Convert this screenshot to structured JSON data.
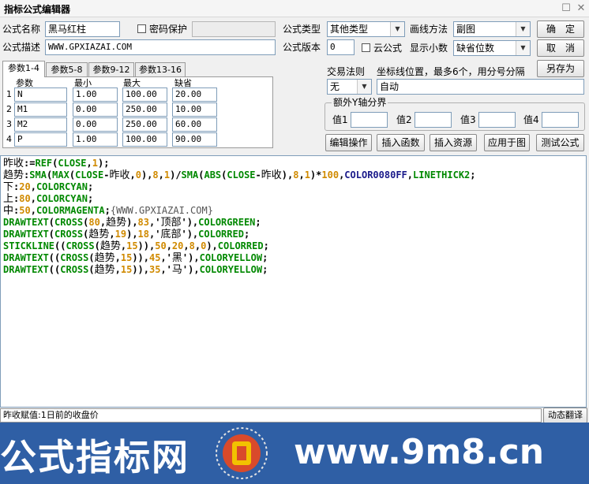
{
  "window": {
    "title": "指标公式编辑器",
    "restore_glyph": "☐",
    "close_glyph": "✕"
  },
  "form": {
    "name_label": "公式名称",
    "name_value": "黑马红柱",
    "password_label": "密码保护",
    "desc_label": "公式描述",
    "desc_value": "WWW.GPXIAZAI.COM",
    "type_label": "公式类型",
    "type_value": "其他类型",
    "draw_label": "画线方法",
    "draw_value": "副图",
    "version_label": "公式版本",
    "version_value": "0",
    "cloud_label": "云公式",
    "decimals_label": "显示小数",
    "decimals_value": "缺省位数"
  },
  "buttons": {
    "ok": "确　定",
    "cancel": "取　消",
    "save_as": "另存为",
    "edit_ops": "编辑操作",
    "insert_fn": "插入函数",
    "insert_res": "插入资源",
    "apply": "应用于图",
    "test": "测试公式"
  },
  "tabs": [
    "参数1-4",
    "参数5-8",
    "参数9-12",
    "参数13-16"
  ],
  "params": {
    "headers": [
      "参数",
      "最小",
      "最大",
      "缺省"
    ],
    "rows": [
      {
        "idx": "1",
        "name": "N",
        "min": "1.00",
        "max": "100.00",
        "def": "20.00"
      },
      {
        "idx": "2",
        "name": "M1",
        "min": "0.00",
        "max": "250.00",
        "def": "10.00"
      },
      {
        "idx": "3",
        "name": "M2",
        "min": "0.00",
        "max": "250.00",
        "def": "60.00"
      },
      {
        "idx": "4",
        "name": "P",
        "min": "1.00",
        "max": "100.00",
        "def": "90.00"
      }
    ]
  },
  "trade": {
    "label": "交易法则",
    "value": "无",
    "coord_label": "坐标线位置，最多6个，用分号分隔",
    "coord_value": "自动"
  },
  "yaxis": {
    "title": "额外Y轴分界",
    "labels": [
      "值1",
      "值2",
      "值3",
      "值4"
    ]
  },
  "code": [
    [
      [
        "cn",
        "昨收"
      ],
      [
        "id",
        ":="
      ],
      [
        "fn",
        "REF"
      ],
      [
        "id",
        "("
      ],
      [
        "fn",
        "CLOSE"
      ],
      [
        "id",
        ","
      ],
      [
        "num",
        "1"
      ],
      [
        "id",
        ");"
      ]
    ],
    [
      [
        "cn",
        "趋势"
      ],
      [
        "id",
        ":"
      ],
      [
        "fn",
        "SMA"
      ],
      [
        "id",
        "("
      ],
      [
        "fn",
        "MAX"
      ],
      [
        "id",
        "("
      ],
      [
        "fn",
        "CLOSE"
      ],
      [
        "id",
        "-"
      ],
      [
        "cn",
        "昨收"
      ],
      [
        "id",
        ","
      ],
      [
        "num",
        "0"
      ],
      [
        "id",
        "),"
      ],
      [
        "num",
        "8"
      ],
      [
        "id",
        ","
      ],
      [
        "num",
        "1"
      ],
      [
        "id",
        ")/"
      ],
      [
        "fn",
        "SMA"
      ],
      [
        "id",
        "("
      ],
      [
        "fn",
        "ABS"
      ],
      [
        "id",
        "("
      ],
      [
        "fn",
        "CLOSE"
      ],
      [
        "id",
        "-"
      ],
      [
        "cn",
        "昨收"
      ],
      [
        "id",
        "),"
      ],
      [
        "num",
        "8"
      ],
      [
        "id",
        ","
      ],
      [
        "num",
        "1"
      ],
      [
        "id",
        ")*"
      ],
      [
        "num",
        "100"
      ],
      [
        "id",
        ","
      ],
      [
        "dark",
        "COLOR0080FF"
      ],
      [
        "id",
        ","
      ],
      [
        "fn",
        "LINETHICK2"
      ],
      [
        "id",
        ";"
      ]
    ],
    [
      [
        "cn",
        "下"
      ],
      [
        "id",
        ":"
      ],
      [
        "num",
        "20"
      ],
      [
        "id",
        ","
      ],
      [
        "fn",
        "COLORCYAN"
      ],
      [
        "id",
        ";"
      ]
    ],
    [
      [
        "cn",
        "上"
      ],
      [
        "id",
        ":"
      ],
      [
        "num",
        "80"
      ],
      [
        "id",
        ","
      ],
      [
        "fn",
        "COLORCYAN"
      ],
      [
        "id",
        ";"
      ]
    ],
    [
      [
        "cn",
        "中"
      ],
      [
        "id",
        ":"
      ],
      [
        "num",
        "50"
      ],
      [
        "id",
        ","
      ],
      [
        "fn",
        "COLORMAGENTA"
      ],
      [
        "id",
        ";"
      ],
      [
        "cm",
        "{WWW.GPXIAZAI.COM}"
      ]
    ],
    [
      [
        "fn",
        "DRAWTEXT"
      ],
      [
        "id",
        "("
      ],
      [
        "fn",
        "CROSS"
      ],
      [
        "id",
        "("
      ],
      [
        "num",
        "80"
      ],
      [
        "id",
        ","
      ],
      [
        "cn",
        "趋势"
      ],
      [
        "id",
        "),"
      ],
      [
        "num",
        "83"
      ],
      [
        "id",
        ",'"
      ],
      [
        "cn",
        "顶部"
      ],
      [
        "id",
        "'),"
      ],
      [
        "fn",
        "COLORGREEN"
      ],
      [
        "id",
        ";"
      ]
    ],
    [
      [
        "fn",
        "DRAWTEXT"
      ],
      [
        "id",
        "("
      ],
      [
        "fn",
        "CROSS"
      ],
      [
        "id",
        "("
      ],
      [
        "cn",
        "趋势"
      ],
      [
        "id",
        ","
      ],
      [
        "num",
        "19"
      ],
      [
        "id",
        "),"
      ],
      [
        "num",
        "18"
      ],
      [
        "id",
        ",'"
      ],
      [
        "cn",
        "底部"
      ],
      [
        "id",
        "'),"
      ],
      [
        "fn",
        "COLORRED"
      ],
      [
        "id",
        ";"
      ]
    ],
    [
      [
        "fn",
        "STICKLINE"
      ],
      [
        "id",
        "(("
      ],
      [
        "fn",
        "CROSS"
      ],
      [
        "id",
        "("
      ],
      [
        "cn",
        "趋势"
      ],
      [
        "id",
        ","
      ],
      [
        "num",
        "15"
      ],
      [
        "id",
        ")),"
      ],
      [
        "num",
        "50"
      ],
      [
        "id",
        ","
      ],
      [
        "num",
        "20"
      ],
      [
        "id",
        ","
      ],
      [
        "num",
        "8"
      ],
      [
        "id",
        ","
      ],
      [
        "num",
        "0"
      ],
      [
        "id",
        "),"
      ],
      [
        "fn",
        "COLORRED"
      ],
      [
        "id",
        ";"
      ]
    ],
    [
      [
        "fn",
        "DRAWTEXT"
      ],
      [
        "id",
        "(("
      ],
      [
        "fn",
        "CROSS"
      ],
      [
        "id",
        "("
      ],
      [
        "cn",
        "趋势"
      ],
      [
        "id",
        ","
      ],
      [
        "num",
        "15"
      ],
      [
        "id",
        ")),"
      ],
      [
        "num",
        "45"
      ],
      [
        "id",
        ",'"
      ],
      [
        "cn",
        "黑"
      ],
      [
        "id",
        "'),"
      ],
      [
        "fn",
        "COLORYELLOW"
      ],
      [
        "id",
        ";"
      ]
    ],
    [
      [
        "fn",
        "DRAWTEXT"
      ],
      [
        "id",
        "(("
      ],
      [
        "fn",
        "CROSS"
      ],
      [
        "id",
        "("
      ],
      [
        "cn",
        "趋势"
      ],
      [
        "id",
        ","
      ],
      [
        "num",
        "15"
      ],
      [
        "id",
        ")),"
      ],
      [
        "num",
        "35"
      ],
      [
        "id",
        ",'"
      ],
      [
        "cn",
        "马"
      ],
      [
        "id",
        "'),"
      ],
      [
        "fn",
        "COLORYELLOW"
      ],
      [
        "id",
        ";"
      ]
    ]
  ],
  "status": {
    "text": "昨收赋值:1日前的收盘价",
    "translate_button": "动态翻译"
  },
  "banner": {
    "left_text": "公式指标网",
    "right_text": "www.9m8.cn"
  },
  "colors": {
    "fn": "#008800",
    "num": "#d08a00",
    "dark": "#1a1a8a",
    "banner": "#2f5fa5"
  }
}
